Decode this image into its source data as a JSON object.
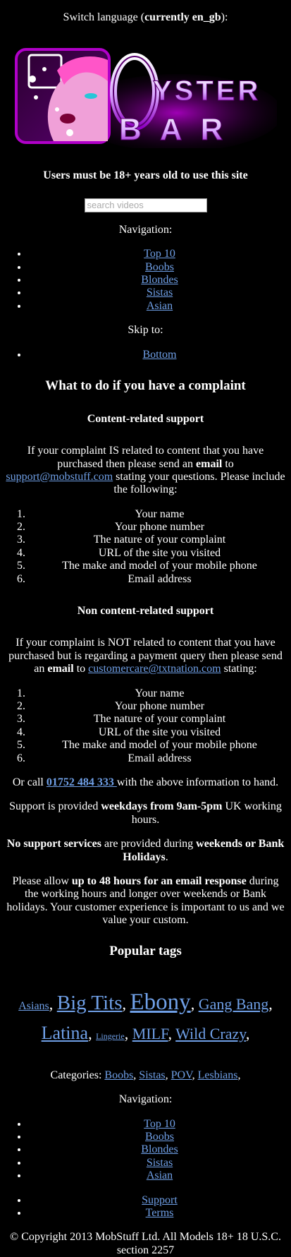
{
  "language": {
    "prefix": "Switch language (",
    "current": "currently en_gb",
    "suffix": "):"
  },
  "logo": {
    "text_top": "YSTER",
    "text_bottom": "BAR",
    "brand_color": "#b100c9"
  },
  "age_notice": "Users must be 18+ years old to use this site",
  "search": {
    "placeholder": "search videos"
  },
  "nav_label": "Navigation:",
  "nav_items": [
    "Top 10",
    "Boobs",
    "Blondes",
    "Sistas",
    "Asian"
  ],
  "skip_label": "Skip to:",
  "skip_items": [
    "Bottom"
  ],
  "complaint": {
    "title": "What to do if you have a complaint",
    "content_title": "Content-related support",
    "content_p1": "If your complaint IS related to content that you have purchased then please send an ",
    "content_email_word": "email",
    "content_p2": " to ",
    "content_email": "support@mobstuff.com",
    "content_p3": " stating your questions. Please include the following:",
    "content_list": [
      "Your name",
      "Your phone number",
      "The nature of your complaint",
      "URL of the site you visited",
      "The make and model of your mobile phone",
      "Email address"
    ],
    "noncontent_title": "Non content-related support",
    "noncontent_p1": "If your complaint is NOT related to content that you have purchased but is regarding a payment query then please send an ",
    "noncontent_email_word": "email",
    "noncontent_p2": " to ",
    "noncontent_email": "customercare@txtnation.com",
    "noncontent_p3": " stating:",
    "noncontent_list": [
      "Your name",
      "Your phone number",
      "The nature of your complaint",
      "URL of the site you visited",
      "The make and model of your mobile phone",
      "Email address"
    ],
    "call_p1": "Or call ",
    "call_number": "01752 484 333 ",
    "call_p2": "with the above information to hand.",
    "hours_p1": "Support is provided ",
    "hours_bold": "weekdays from 9am-5pm",
    "hours_p2": " UK working hours.",
    "nosupport_bold1": "No support services",
    "nosupport_p1": " are provided during ",
    "nosupport_bold2": "weekends or Bank Holidays",
    "nosupport_p2": ".",
    "allow_p1": "Please allow ",
    "allow_bold": "up to 48 hours for an email response",
    "allow_p2": " during the working hours and longer over weekends or Bank holidays. Your customer experience is important to us and we value your custom."
  },
  "popular_tags": {
    "title": "Popular tags",
    "tags": [
      {
        "label": "Asians",
        "size": 16
      },
      {
        "label": "Big Tits",
        "size": 29
      },
      {
        "label": "Ebony",
        "size": 33
      },
      {
        "label": "Gang Bang",
        "size": 22
      },
      {
        "label": "Latina",
        "size": 26
      },
      {
        "label": "Lingerie",
        "size": 12
      },
      {
        "label": "MILF",
        "size": 22
      },
      {
        "label": "Wild Crazy",
        "size": 22
      }
    ]
  },
  "categories": {
    "label": "Categories: ",
    "items": [
      "Boobs",
      "Sistas",
      "POV",
      "Lesbians"
    ]
  },
  "footer_nav_label": "Navigation:",
  "footer_nav_items": [
    "Top 10",
    "Boobs",
    "Blondes",
    "Sistas",
    "Asian"
  ],
  "footer_links": [
    "Support",
    "Terms"
  ],
  "copyright": "© Copyright 2013 MobStuff Ltd. All Models 18+ 18 U.S.C. section 2257"
}
